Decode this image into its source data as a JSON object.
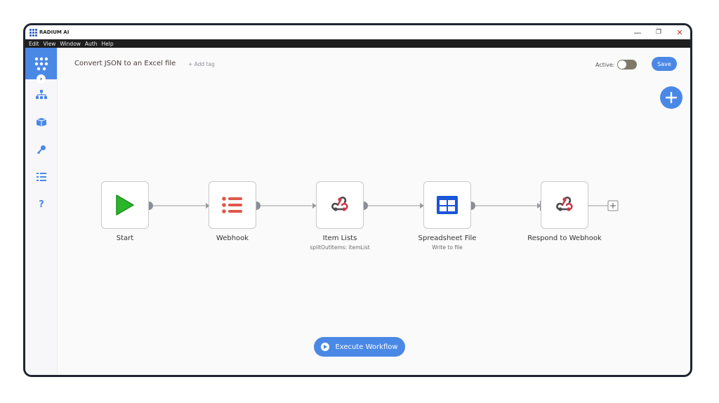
{
  "app": {
    "name": "RADIUM AI"
  },
  "window_controls": {
    "minimize": "—",
    "maximize": "❐",
    "close": "✕"
  },
  "menu": [
    "Edit",
    "View",
    "Window",
    "Auth",
    "Help"
  ],
  "sidebar": {
    "items": [
      {
        "icon": "network-icon"
      },
      {
        "icon": "box-icon"
      },
      {
        "icon": "key-icon"
      },
      {
        "icon": "list-check-icon"
      },
      {
        "icon": "help-icon",
        "label": "?"
      }
    ],
    "collapse_label": "›"
  },
  "header": {
    "title": "Convert JSON to an Excel file",
    "add_tag": "+ Add tag",
    "active_label": "Active:",
    "active": false,
    "save_label": "Save"
  },
  "nodes": [
    {
      "label": "Start",
      "sublabel": "",
      "icon": "play-icon"
    },
    {
      "label": "Webhook",
      "sublabel": "",
      "icon": "list-icon"
    },
    {
      "label": "Item Lists",
      "sublabel": "splitOutItems: itemList",
      "icon": "webhook-icon"
    },
    {
      "label": "Spreadsheet File",
      "sublabel": "Write to file",
      "icon": "table-icon"
    },
    {
      "label": "Respond to Webhook",
      "sublabel": "",
      "icon": "webhook-icon"
    }
  ],
  "execute_label": "Execute Workflow",
  "colors": {
    "accent": "#4a88e6",
    "start_green": "#2ab52a",
    "webhook_red": "#e0574a",
    "sheet_blue": "#1a56d6"
  }
}
